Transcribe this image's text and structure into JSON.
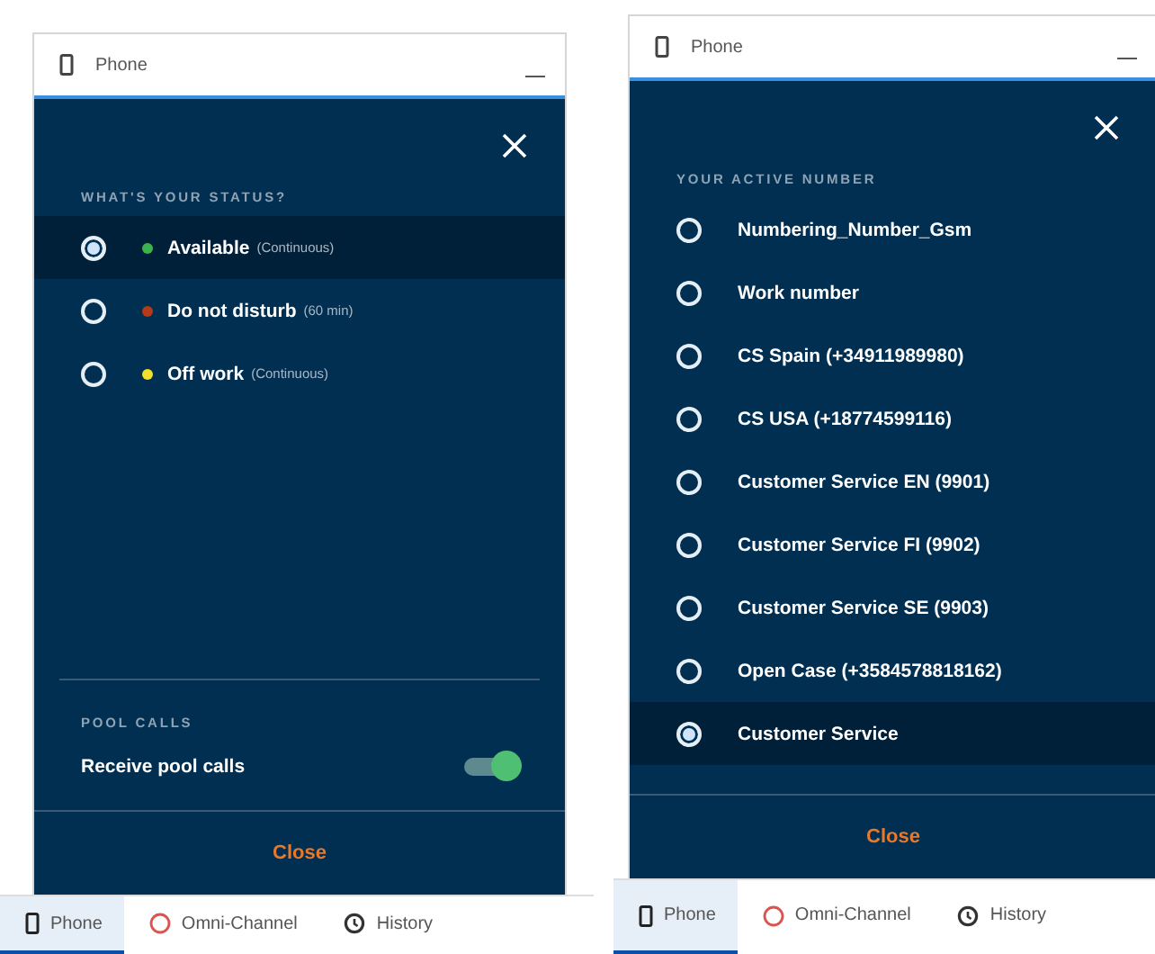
{
  "screens": [
    {
      "header": {
        "title": "Phone"
      },
      "section_title": "WHAT'S YOUR STATUS?",
      "options": [
        {
          "label": "Available",
          "note": "(Continuous)",
          "color": "#3cb44b",
          "selected": true
        },
        {
          "label": "Do not disturb",
          "note": "(60 min)",
          "color": "#b33a1a",
          "selected": false
        },
        {
          "label": "Off work",
          "note": "(Continuous)",
          "color": "#f2e12b",
          "selected": false
        }
      ],
      "pool": {
        "title": "POOL CALLS",
        "label": "Receive pool calls",
        "on": true
      },
      "close": "Close",
      "tabs": [
        {
          "kind": "phone",
          "label": "Phone",
          "selected": true
        },
        {
          "kind": "omni",
          "label": "Omni-Channel",
          "selected": false
        },
        {
          "kind": "history",
          "label": "History",
          "selected": false
        }
      ]
    },
    {
      "header": {
        "title": "Phone"
      },
      "section_title": "YOUR ACTIVE NUMBER",
      "options": [
        {
          "label": "Numbering_Number_Gsm",
          "selected": false
        },
        {
          "label": "Work number",
          "selected": false
        },
        {
          "label": "CS Spain (+34911989980)",
          "selected": false
        },
        {
          "label": "CS USA (+18774599116)",
          "selected": false
        },
        {
          "label": "Customer Service EN (9901)",
          "selected": false
        },
        {
          "label": "Customer Service FI (9902)",
          "selected": false
        },
        {
          "label": "Customer Service SE (9903)",
          "selected": false
        },
        {
          "label": "Open Case (+3584578818162)",
          "selected": false
        },
        {
          "label": "Customer Service",
          "selected": true
        }
      ],
      "close": "Close",
      "tabs": [
        {
          "kind": "phone",
          "label": "Phone",
          "selected": true
        },
        {
          "kind": "omni",
          "label": "Omni-Channel",
          "selected": false
        },
        {
          "kind": "history",
          "label": "History",
          "selected": false
        }
      ]
    }
  ]
}
